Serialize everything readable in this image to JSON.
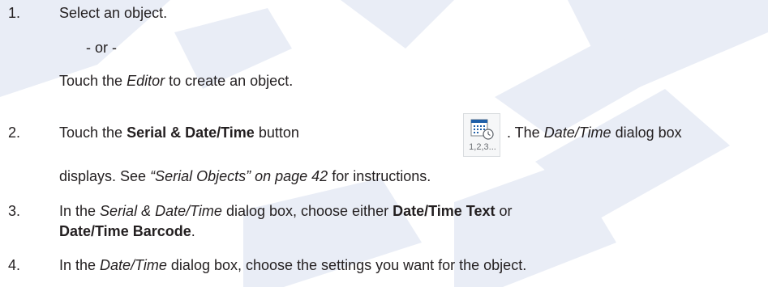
{
  "steps": [
    {
      "number": "1.",
      "line1": "Select an object.",
      "or_text": "- or -",
      "line2": "Touch the ",
      "line2_italic": "Editor",
      "line2_end": " to create an object."
    },
    {
      "number": "2.",
      "a": "Touch the ",
      "a_bold": "Serial & Date/Time",
      "a_end": " button",
      "b": ". The ",
      "b_italic": "Date/Time",
      "b_end": " dialog box",
      "c": "displays. See ",
      "c_italic": "“Serial Objects” on page 42",
      "c_end": " for instructions.",
      "icon": {
        "name": "serial-date-time-icon",
        "caption": "1,2,3...",
        "accent": "#1f5fa8"
      }
    },
    {
      "number": "3.",
      "a": "In the ",
      "a_italic": "Serial & Date/Time",
      "a_mid": " dialog box, choose either ",
      "a_bold": "Date/Time Text",
      "a_end": " or",
      "b_bold": "Date/Time Barcode",
      "b_end": "."
    },
    {
      "number": "4.",
      "a": "In the ",
      "a_italic": "Date/Time",
      "a_end": " dialog box, choose the settings you want for the object."
    }
  ],
  "watermark": {
    "color": "#e6eaf4"
  }
}
